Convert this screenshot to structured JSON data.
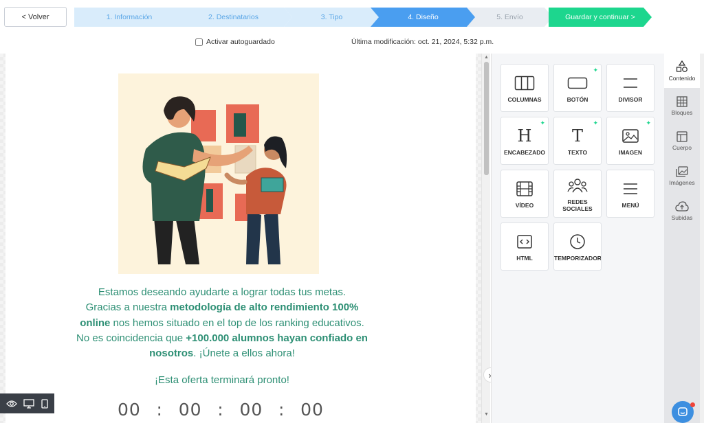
{
  "nav": {
    "back_label": "< Volver",
    "steps": [
      {
        "label": "1. Información",
        "state": "done"
      },
      {
        "label": "2. Destinatarios",
        "state": "done"
      },
      {
        "label": "3. Tipo",
        "state": "done"
      },
      {
        "label": "4. Diseño",
        "state": "active"
      },
      {
        "label": "5. Envío",
        "state": "todo"
      }
    ],
    "save_label": "Guardar y continuar >"
  },
  "subbar": {
    "autosave_label": "Activar autoguardado",
    "autosave_checked": false,
    "last_modified": "Última modificación: oct. 21, 2024, 5:32 p.m."
  },
  "email": {
    "hero_image": "illustration-teacher-student-books",
    "body_line1": "Estamos deseando ayudarte a lograr todas tus metas.",
    "body_line2a": "Gracias a nuestra ",
    "body_bold1": "metodología de alto rendimiento 100% online",
    "body_line3": " nos hemos situado en el top de los ranking educativos.",
    "body_line4": "No es coincidencia que ",
    "body_bold2": "+100.000 alumnos hayan confiado en nosotros",
    "body_line5": ". ¡Únete a ellos ahora!",
    "offer": "¡Esta oferta terminará pronto!",
    "timer": [
      "00",
      ":",
      "00",
      ":",
      "00",
      ":",
      "00"
    ]
  },
  "content_tiles": [
    {
      "label": "COLUMNAS",
      "icon": "columns-icon",
      "spark": false
    },
    {
      "label": "BOTÓN",
      "icon": "button-icon",
      "spark": true
    },
    {
      "label": "DIVISOR",
      "icon": "divider-icon",
      "spark": false
    },
    {
      "label": "ENCABEZADO",
      "icon": "heading-icon",
      "spark": true
    },
    {
      "label": "TEXTO",
      "icon": "text-icon",
      "spark": true
    },
    {
      "label": "IMAGEN",
      "icon": "image-icon",
      "spark": true
    },
    {
      "label": "VÍDEO",
      "icon": "video-icon",
      "spark": false
    },
    {
      "label": "REDES SOCIALES",
      "icon": "social-icon",
      "spark": false
    },
    {
      "label": "MENÚ",
      "icon": "menu-icon",
      "spark": false
    },
    {
      "label": "HTML",
      "icon": "html-icon",
      "spark": false
    },
    {
      "label": "TEMPORIZADOR",
      "icon": "timer-icon",
      "spark": false
    }
  ],
  "rail": [
    {
      "label": "Contenido",
      "icon": "shapes-icon",
      "active": true
    },
    {
      "label": "Bloques",
      "icon": "blocks-icon",
      "active": false
    },
    {
      "label": "Cuerpo",
      "icon": "layout-icon",
      "active": false
    },
    {
      "label": "Imágenes",
      "icon": "images-icon",
      "active": false
    },
    {
      "label": "Subidas",
      "icon": "cloud-upload-icon",
      "active": false
    }
  ],
  "colors": {
    "accent_blue": "#4a9ef0",
    "save_green": "#1dd68e",
    "text_green": "#2d8f74"
  }
}
